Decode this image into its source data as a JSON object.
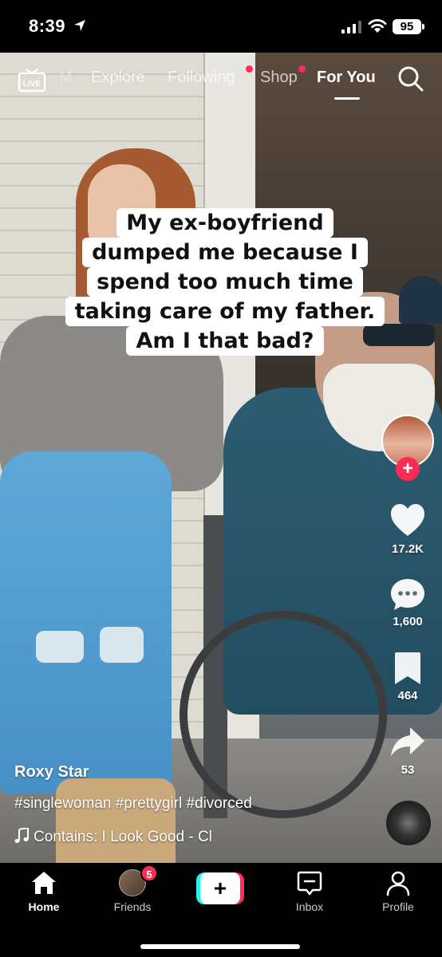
{
  "status_bar": {
    "time": "8:39",
    "battery": "95"
  },
  "top_nav": {
    "live_label": "LIVE",
    "faded_item": "M",
    "items": [
      {
        "label": "Explore",
        "dot": false
      },
      {
        "label": "Following",
        "dot": true
      },
      {
        "label": "Shop",
        "dot": true
      },
      {
        "label": "For You",
        "active": true
      }
    ],
    "accent_color": "#fe2c55"
  },
  "video": {
    "caption_lines": [
      "My ex-boyfriend",
      "dumped me because I",
      "spend too much time",
      "taking care of my father.",
      "Am I that bad?"
    ]
  },
  "right_rail": {
    "like_count": "17.2K",
    "comment_count": "1,600",
    "save_count": "464",
    "share_count": "53"
  },
  "post": {
    "author": "Roxy Star",
    "hashtags": "#singlewoman #prettygirl #divorced",
    "music": "Contains: I Look Good - Cl"
  },
  "tab_bar": {
    "tabs": [
      {
        "label": "Home",
        "icon": "home-icon",
        "active": true
      },
      {
        "label": "Friends",
        "icon": "friends-avatar",
        "badge": "5"
      },
      {
        "label": "",
        "icon": "create-icon"
      },
      {
        "label": "Inbox",
        "icon": "inbox-icon"
      },
      {
        "label": "Profile",
        "icon": "profile-icon"
      }
    ],
    "create_symbol": "+"
  }
}
